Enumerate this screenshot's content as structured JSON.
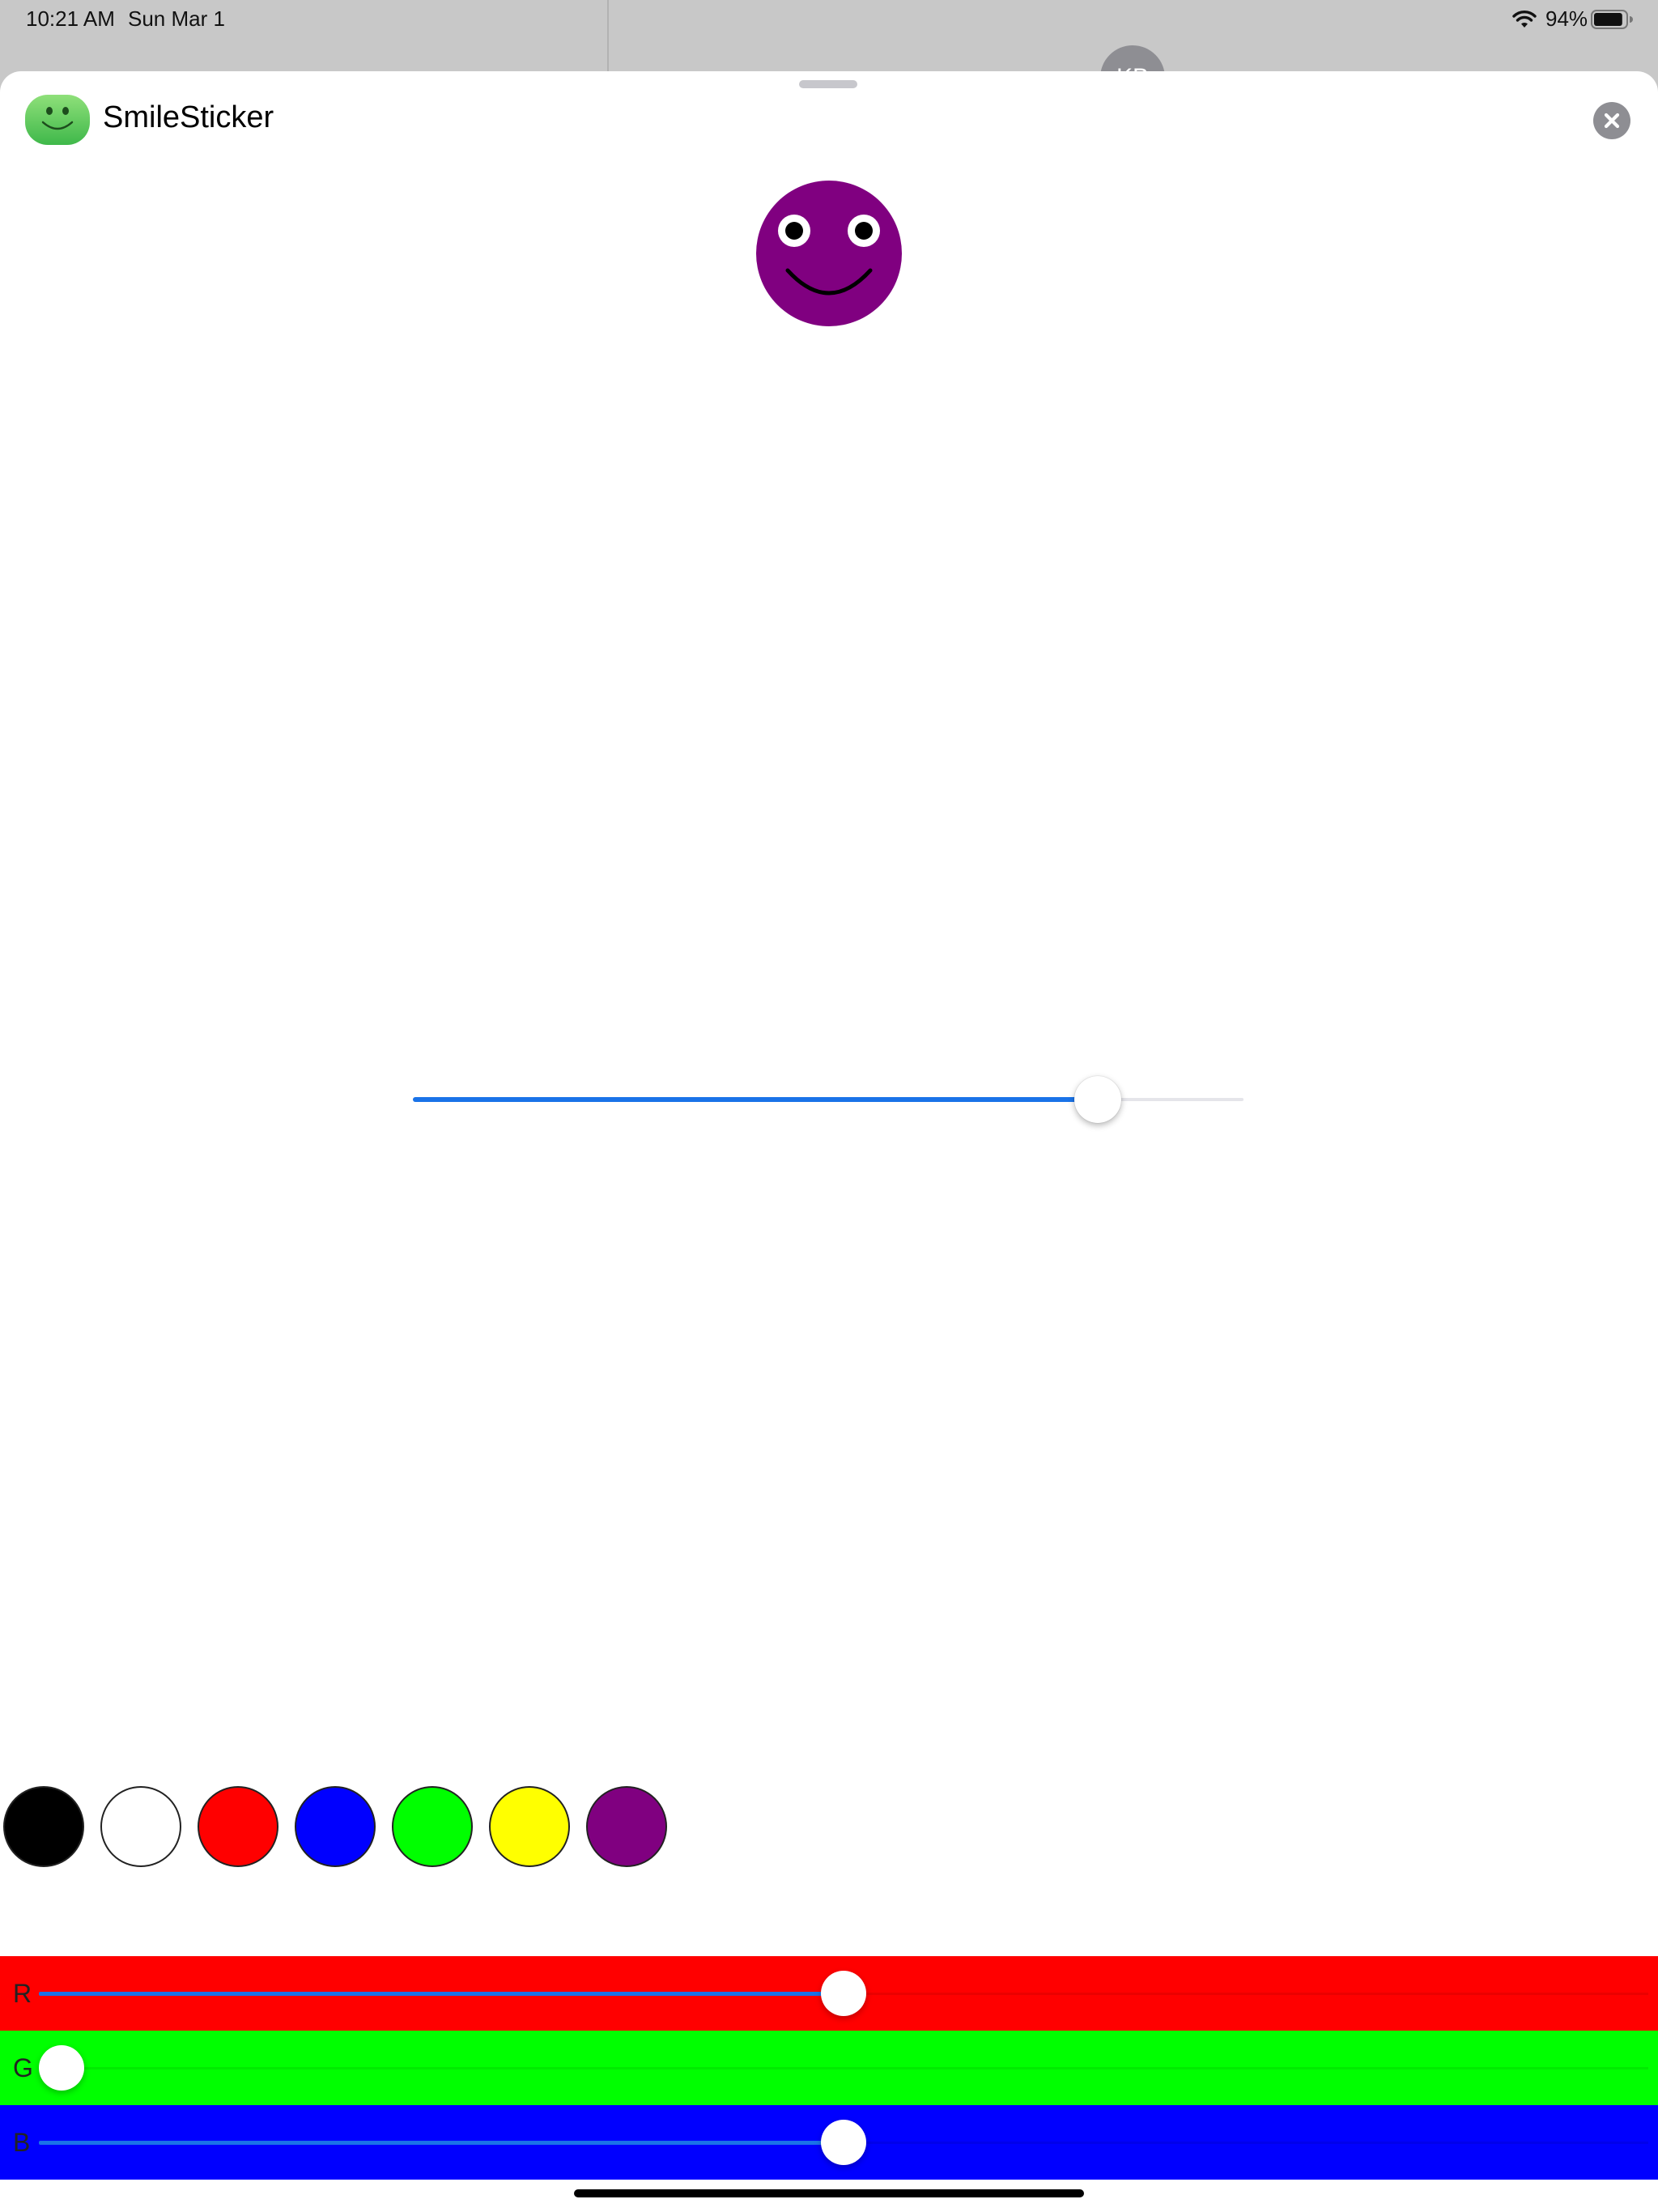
{
  "status_bar": {
    "time": "10:21 AM",
    "date": "Sun Mar 1",
    "battery_percent": "94%",
    "battery_level": 0.94,
    "wifi_icon": "wifi-icon",
    "battery_icon": "battery-icon"
  },
  "background": {
    "avatar_initials": "KB"
  },
  "sheet": {
    "app_name": "SmileSticker",
    "app_icon": "smiley-app-icon",
    "close_icon": "close-icon"
  },
  "sticker": {
    "face_color": "#800080"
  },
  "size_slider": {
    "value": 0.825
  },
  "color_swatches": [
    {
      "name": "black",
      "color": "#000000"
    },
    {
      "name": "white",
      "color": "#ffffff"
    },
    {
      "name": "red",
      "color": "#ff0000"
    },
    {
      "name": "blue",
      "color": "#0000ff"
    },
    {
      "name": "green",
      "color": "#00ff00"
    },
    {
      "name": "yellow",
      "color": "#ffff00"
    },
    {
      "name": "purple",
      "color": "#800080"
    }
  ],
  "rgb_sliders": [
    {
      "label": "R",
      "background": "#ff0000",
      "value": 0.5
    },
    {
      "label": "G",
      "background": "#00ff00",
      "value": 0.0
    },
    {
      "label": "B",
      "background": "#0000ff",
      "value": 0.5
    }
  ]
}
